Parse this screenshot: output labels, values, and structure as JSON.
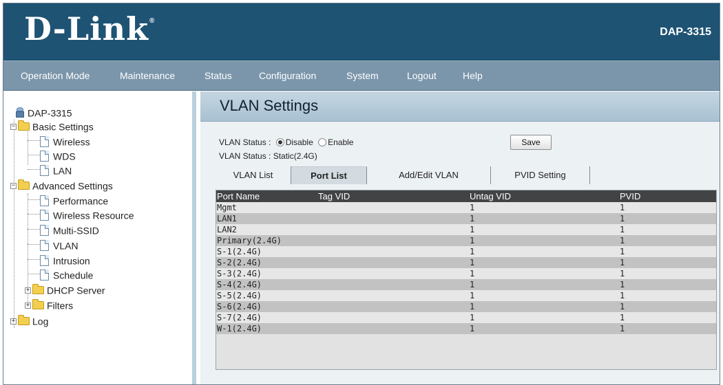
{
  "header": {
    "brand": "D-Link",
    "model": "DAP-3315"
  },
  "nav": {
    "items": [
      "Operation Mode",
      "Maintenance",
      "Status",
      "Configuration",
      "System",
      "Logout",
      "Help"
    ]
  },
  "sidebar": {
    "root": "DAP-3315",
    "basic_settings": "Basic Settings",
    "basic_items": [
      "Wireless",
      "WDS",
      "LAN"
    ],
    "advanced_settings": "Advanced Settings",
    "advanced_items": [
      "Performance",
      "Wireless Resource",
      "Multi-SSID",
      "VLAN",
      "Intrusion",
      "Schedule"
    ],
    "dhcp_server": "DHCP Server",
    "filters": "Filters",
    "log": "Log"
  },
  "page": {
    "title": "VLAN Settings",
    "vlan_status_label": "VLAN Status :",
    "disable_label": "Disable",
    "enable_label": "Enable",
    "vlan_status_selected": "Disable",
    "vlan_status_static": "VLAN Status : Static(2.4G)",
    "save_label": "Save"
  },
  "tabs": {
    "items": [
      "VLAN List",
      "Port List",
      "Add/Edit VLAN",
      "PVID Setting"
    ],
    "active": "Port List"
  },
  "port_table": {
    "columns": [
      "Port Name",
      "Tag VID",
      "Untag VID",
      "PVID"
    ],
    "rows": [
      [
        "Mgmt",
        "",
        "1",
        "1"
      ],
      [
        "LAN1",
        "",
        "1",
        "1"
      ],
      [
        "LAN2",
        "",
        "1",
        "1"
      ],
      [
        "Primary(2.4G)",
        "",
        "1",
        "1"
      ],
      [
        "S-1(2.4G)",
        "",
        "1",
        "1"
      ],
      [
        "S-2(2.4G)",
        "",
        "1",
        "1"
      ],
      [
        "S-3(2.4G)",
        "",
        "1",
        "1"
      ],
      [
        "S-4(2.4G)",
        "",
        "1",
        "1"
      ],
      [
        "S-5(2.4G)",
        "",
        "1",
        "1"
      ],
      [
        "S-6(2.4G)",
        "",
        "1",
        "1"
      ],
      [
        "S-7(2.4G)",
        "",
        "1",
        "1"
      ],
      [
        "W-1(2.4G)",
        "",
        "1",
        "1"
      ]
    ]
  }
}
